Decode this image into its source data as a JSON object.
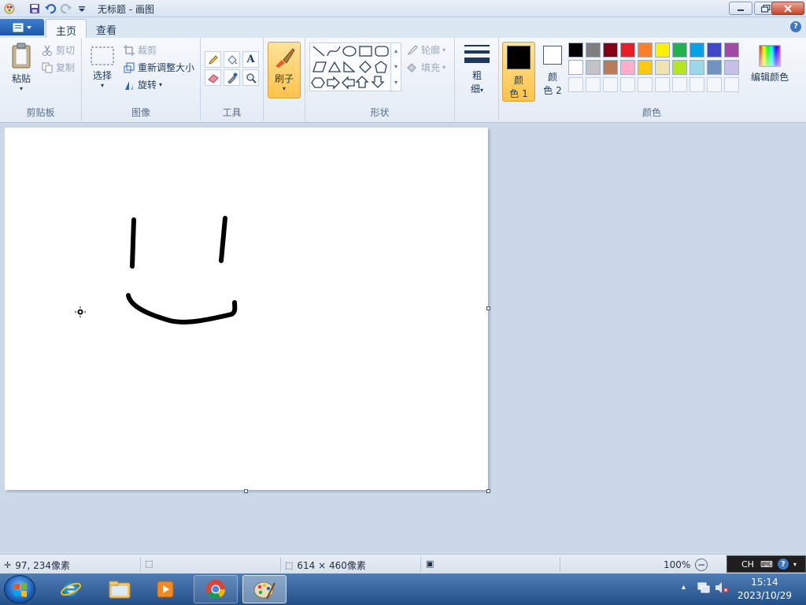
{
  "window": {
    "title": "无标题 - 画图",
    "minimize_icon": "minimize-icon",
    "maximize_icon": "restore-icon",
    "close_icon": "close-icon"
  },
  "ribbon_tabs": {
    "app_menu_icon": "app-menu-icon",
    "home": "主页",
    "view": "查看",
    "help_icon": "help-icon"
  },
  "clipboard": {
    "paste": "粘贴",
    "cut": "剪切",
    "copy": "复制",
    "group": "剪贴板"
  },
  "image": {
    "select": "选择",
    "crop": "裁剪",
    "resize": "重新调整大小",
    "rotate": "旋转",
    "group": "图像"
  },
  "tools": {
    "group": "工具",
    "items": [
      "pencil-icon",
      "fill-icon",
      "text-icon",
      "eraser-icon",
      "color-picker-icon",
      "magnifier-icon"
    ]
  },
  "brush": {
    "label": "刷子"
  },
  "shapes": {
    "outline": "轮廓",
    "fill": "填充",
    "group": "形状"
  },
  "size": {
    "label_line1": "粗",
    "label_line2": "细"
  },
  "colors": {
    "color1_line1": "颜",
    "color1_line2": "色 1",
    "color2_line1": "颜",
    "color2_line2": "色 2",
    "edit": "编辑颜色",
    "group": "颜色",
    "color1_value": "#000000",
    "color2_value": "#ffffff",
    "row1": [
      "#000000",
      "#7f7f7f",
      "#880015",
      "#ed1c24",
      "#ff7f27",
      "#fff200",
      "#22b14c",
      "#00a2e8",
      "#3f48cc",
      "#a349a4"
    ],
    "row2": [
      "#ffffff",
      "#c3c3c3",
      "#b97a57",
      "#ffaec9",
      "#ffc90e",
      "#efe4b0",
      "#b5e61d",
      "#99d9ea",
      "#7092be",
      "#c8bfe7"
    ]
  },
  "canvas": {
    "strokes": "smiley"
  },
  "status": {
    "cursor_pos": "97, 234像素",
    "image_size": "614 × 460像素",
    "zoom": "100%"
  },
  "langbar": {
    "lang": "CH"
  },
  "taskbar": {
    "time": "15:14",
    "date": "2023/10/29"
  }
}
